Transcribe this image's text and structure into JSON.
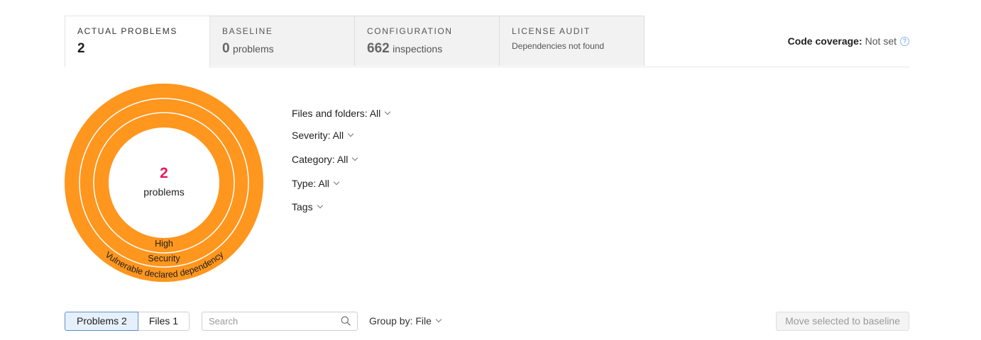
{
  "tabs": [
    {
      "title": "ACTUAL PROBLEMS",
      "value": "2",
      "unit": ""
    },
    {
      "title": "BASELINE",
      "value": "0",
      "unit": "problems"
    },
    {
      "title": "CONFIGURATION",
      "value": "662",
      "unit": "inspections"
    },
    {
      "title": "LICENSE AUDIT",
      "subtitle": "Dependencies not found"
    }
  ],
  "coverage": {
    "label": "Code coverage:",
    "value": "Not set",
    "help_icon": "question-circle-icon"
  },
  "donut": {
    "count": "2",
    "count_label": "problems",
    "rings": [
      {
        "label": "High"
      },
      {
        "label": "Security"
      },
      {
        "label": "Vulnerable declared dependency"
      }
    ],
    "colors": {
      "ring": "#ff961e",
      "count": "#e6195a",
      "separator": "#ffffff"
    }
  },
  "filters": [
    {
      "label": "Files and folders: All"
    },
    {
      "label": "Severity: All"
    },
    {
      "label": "Category: All"
    },
    {
      "label": "Type: All"
    },
    {
      "label": "Tags"
    }
  ],
  "toolbar": {
    "problems_toggle": "Problems 2",
    "files_toggle": "Files 1",
    "search_placeholder": "Search",
    "group_by": "Group by: File",
    "move_button": "Move selected to baseline"
  },
  "colors": {
    "accent": "#5f8fd0",
    "selected_bg": "#e6f0fb"
  }
}
